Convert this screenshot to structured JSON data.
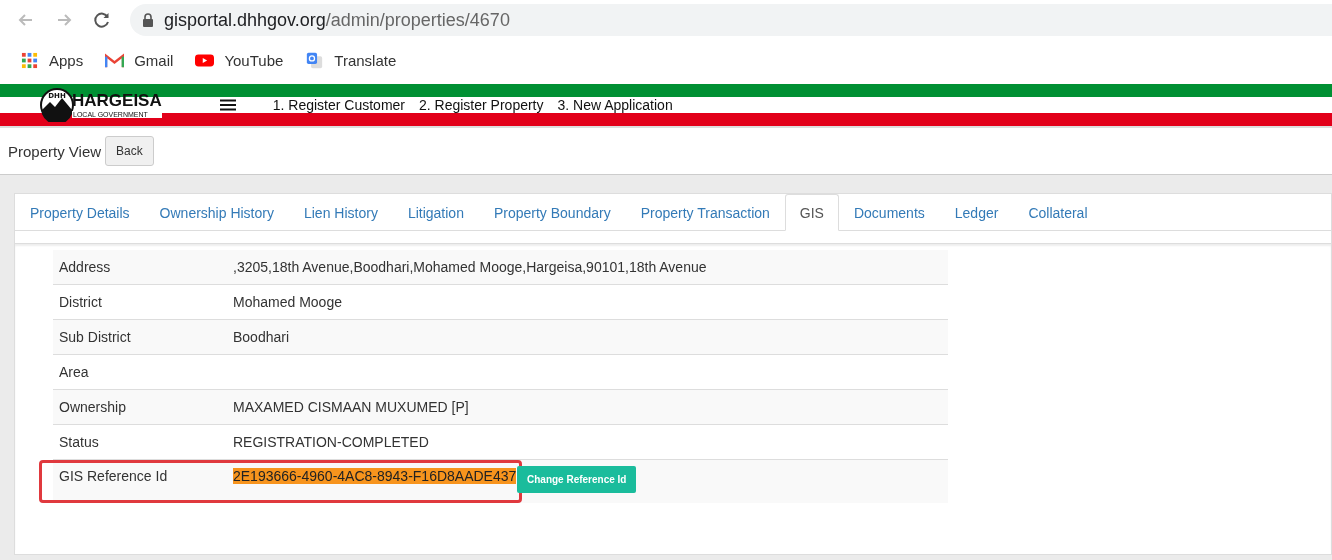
{
  "browser": {
    "url_host": "gisportal.dhhgov.org",
    "url_path": "/admin/properties/4670",
    "bookmarks": [
      {
        "label": "Apps",
        "kind": "apps"
      },
      {
        "label": "Gmail",
        "kind": "gmail"
      },
      {
        "label": "YouTube",
        "kind": "youtube"
      },
      {
        "label": "Translate",
        "kind": "translate"
      }
    ]
  },
  "header": {
    "logo_mark": "DHH",
    "logo_title": "HARGEISA",
    "logo_subtitle": "LOCAL GOVERNMENT",
    "nav": [
      "1. Register Customer",
      "2. Register Property",
      "3. New Application"
    ]
  },
  "page": {
    "title": "Property View",
    "back_button": "Back"
  },
  "tabs": [
    {
      "label": "Property Details",
      "selected": false
    },
    {
      "label": "Ownership History",
      "selected": false
    },
    {
      "label": "Lien History",
      "selected": false
    },
    {
      "label": "Litigation",
      "selected": false
    },
    {
      "label": "Property Boundary",
      "selected": false
    },
    {
      "label": "Property Transaction",
      "selected": false
    },
    {
      "label": "GIS",
      "selected": true
    },
    {
      "label": "Documents",
      "selected": false
    },
    {
      "label": "Ledger",
      "selected": false
    },
    {
      "label": "Collateral",
      "selected": false
    }
  ],
  "rows": [
    {
      "label": "Address",
      "value": ",3205,18th Avenue,Boodhari,Mohamed Mooge,Hargeisa,90101,18th Avenue",
      "outlined": false,
      "value_highlighted": false
    },
    {
      "label": "District",
      "value": "Mohamed Mooge",
      "outlined": false,
      "value_highlighted": false
    },
    {
      "label": "Sub District",
      "value": "Boodhari",
      "outlined": false,
      "value_highlighted": false
    },
    {
      "label": "Area",
      "outlined": false
    },
    {
      "label": "Ownership",
      "value": "MAXAMED CISMAAN MUXUMED [P]",
      "outlined": false,
      "value_highlighted": false
    },
    {
      "label": "Status",
      "value": "REGISTRATION-COMPLETED",
      "outlined": false,
      "value_highlighted": false
    },
    {
      "label": "GIS Reference Id",
      "value": "2E193666-4960-4AC8-8943-F16D8AADE437",
      "button": "Change Reference Id",
      "outlined": true,
      "value_highlighted": true
    }
  ]
}
